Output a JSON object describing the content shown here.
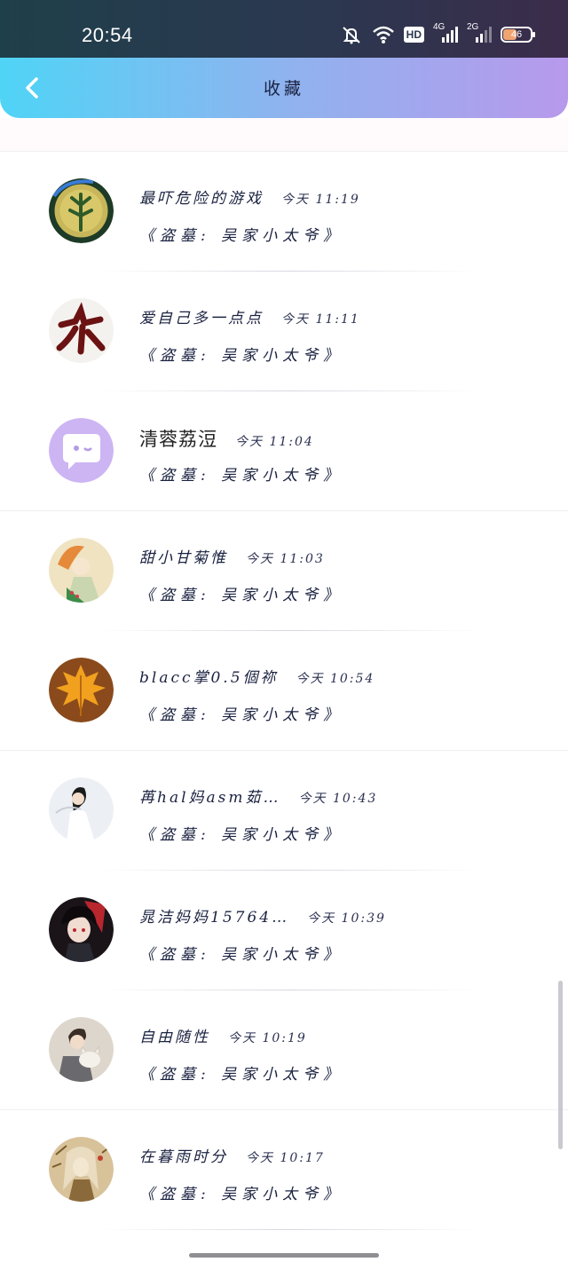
{
  "status_bar": {
    "time": "20:54",
    "icons": [
      "mute-bell-icon",
      "wifi-icon",
      "hd-icon",
      "signal-4g-icon",
      "signal-2g-icon",
      "battery-icon"
    ],
    "hd_label": "HD",
    "net1_label": "4G",
    "net2_label": "2G",
    "battery_level": "46",
    "battery_fraction": 0.46,
    "battery_color": "#f0a472"
  },
  "header": {
    "title": "收藏",
    "back_icon": "chevron-left-icon",
    "gradient": [
      "#4fd4f6",
      "#8fb3ef",
      "#b799ec"
    ]
  },
  "favorites": [
    {
      "username": "最吓危险的游戏",
      "time": "今天 11:19",
      "book": "《盗墓: 吴家小太爷》",
      "avatar": "green-coin-avatar"
    },
    {
      "username": "爱自己多一点点",
      "time": "今天 11:11",
      "book": "《盗墓: 吴家小太爷》",
      "avatar": "calligraphy-avatar"
    },
    {
      "username": "清蓉荔浢",
      "time": "今天 11:04",
      "book": "《盗墓: 吴家小太爷》",
      "avatar": "default-chat-avatar"
    },
    {
      "username": "甜小甘菊惟",
      "time": "今天 11:03",
      "book": "《盗墓: 吴家小太爷》",
      "avatar": "anime-girl-avatar"
    },
    {
      "username": "blacc掌0.5個祢",
      "time": "今天 10:54",
      "book": "《盗墓: 吴家小太爷》",
      "avatar": "maple-leaf-avatar"
    },
    {
      "username": "苒hal妈asm茹…",
      "time": "今天 10:43",
      "book": "《盗墓: 吴家小太爷》",
      "avatar": "girl-white-dress-avatar"
    },
    {
      "username": "晁洁妈妈15764…",
      "time": "今天 10:39",
      "book": "《盗墓: 吴家小太爷》",
      "avatar": "dark-anime-avatar"
    },
    {
      "username": "自由随性",
      "time": "今天 10:19",
      "book": "《盗墓: 吴家小太爷》",
      "avatar": "boy-with-cat-avatar"
    },
    {
      "username": "在暮雨时分",
      "time": "今天 10:17",
      "book": "《盗墓: 吴家小太爷》",
      "avatar": "sepia-anime-avatar"
    }
  ]
}
